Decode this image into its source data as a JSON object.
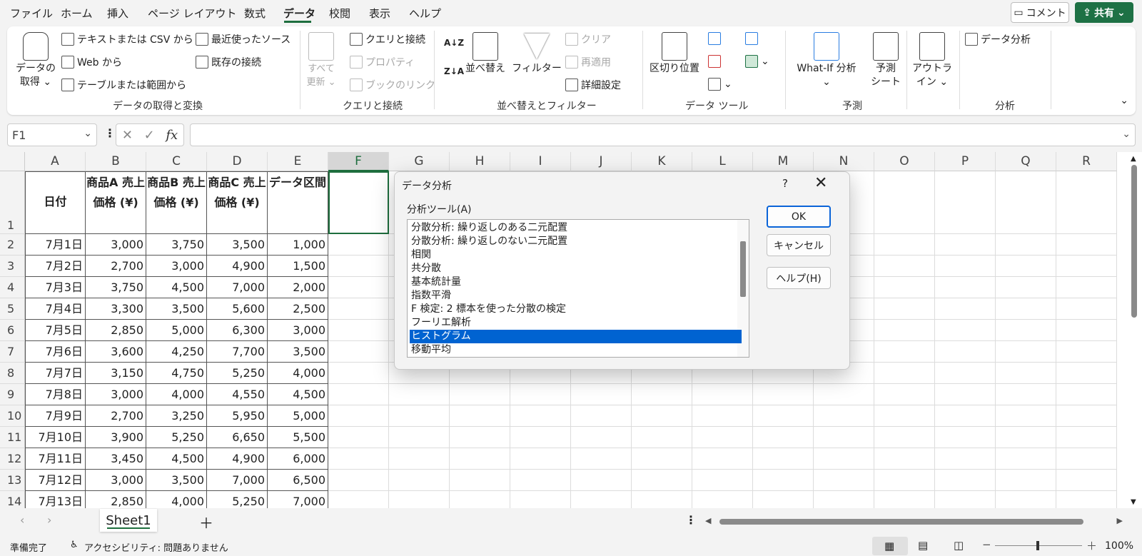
{
  "menu": {
    "items": [
      "ファイル",
      "ホーム",
      "挿入",
      "ページ レイアウト",
      "数式",
      "データ",
      "校閲",
      "表示",
      "ヘルプ"
    ],
    "active": "データ",
    "comment": "コメント",
    "share": "共有"
  },
  "ribbon": {
    "get": {
      "get_data": "データの\n取得 ⌄",
      "text_csv": "テキストまたは CSV から",
      "web": "Web から",
      "table_range": "テーブルまたは範囲から",
      "recent": "最近使ったソース",
      "existing": "既存の接続",
      "label": "データの取得と変換"
    },
    "query": {
      "refresh_all": "すべて\n更新 ⌄",
      "queries": "クエリと接続",
      "properties": "プロパティ",
      "links": "ブックのリンク",
      "label": "クエリと接続"
    },
    "sort": {
      "sort": "並べ替え",
      "filter": "フィルター",
      "clear": "クリア",
      "reapply": "再適用",
      "advanced": "詳細設定",
      "label": "並べ替えとフィルター"
    },
    "tools": {
      "text_to_columns": "区切り位置",
      "label": "データ ツール"
    },
    "forecast": {
      "whatif": "What-If 分析\n⌄",
      "sheet": "予測\nシート",
      "label": "予測"
    },
    "outline": {
      "outline": "アウトラ\nイン ⌄"
    },
    "analysis": {
      "data_analysis": "データ分析",
      "label": "分析"
    }
  },
  "formula_bar": {
    "name_box": "F1",
    "value": ""
  },
  "columns": [
    "A",
    "B",
    "C",
    "D",
    "E",
    "F",
    "G",
    "H",
    "I",
    "J",
    "K",
    "L",
    "M",
    "N",
    "O",
    "P",
    "Q",
    "R"
  ],
  "selected_column": "F",
  "header_row": [
    "日付",
    "商品A 売上価格 (¥)",
    "商品B 売上価格 (¥)",
    "商品C 売上価格 (¥)",
    "データ区間"
  ],
  "rows": [
    [
      "7月1日",
      "3,000",
      "3,750",
      "3,500",
      "1,000"
    ],
    [
      "7月2日",
      "2,700",
      "3,000",
      "4,900",
      "1,500"
    ],
    [
      "7月3日",
      "3,750",
      "4,500",
      "7,000",
      "2,000"
    ],
    [
      "7月4日",
      "3,300",
      "3,500",
      "5,600",
      "2,500"
    ],
    [
      "7月5日",
      "2,850",
      "5,000",
      "6,300",
      "3,000"
    ],
    [
      "7月6日",
      "3,600",
      "4,250",
      "7,700",
      "3,500"
    ],
    [
      "7月7日",
      "3,150",
      "4,750",
      "5,250",
      "4,000"
    ],
    [
      "7月8日",
      "3,000",
      "4,000",
      "4,550",
      "4,500"
    ],
    [
      "7月9日",
      "2,700",
      "3,250",
      "5,950",
      "5,000"
    ],
    [
      "7月10日",
      "3,900",
      "5,250",
      "6,650",
      "5,500"
    ],
    [
      "7月11日",
      "3,450",
      "4,500",
      "4,900",
      "6,000"
    ],
    [
      "7月12日",
      "3,000",
      "3,500",
      "7,000",
      "6,500"
    ],
    [
      "7月13日",
      "2,850",
      "4,000",
      "5,250",
      "7,000"
    ]
  ],
  "dialog": {
    "title": "データ分析",
    "help_q": "?",
    "tools_label": "分析ツール(A)",
    "items": [
      "分散分析: 繰り返しのある二元配置",
      "分散分析: 繰り返しのない二元配置",
      "相関",
      "共分散",
      "基本統計量",
      "指数平滑",
      "F 検定: 2 標本を使った分散の検定",
      "フーリエ解析",
      "ヒストグラム",
      "移動平均"
    ],
    "selected": "ヒストグラム",
    "ok": "OK",
    "cancel": "キャンセル",
    "help": "ヘルプ(H)"
  },
  "sheet_tab": "Sheet1",
  "status": {
    "ready": "準備完了",
    "accessibility": "アクセシビリティ: 問題ありません",
    "zoom": "100%"
  }
}
